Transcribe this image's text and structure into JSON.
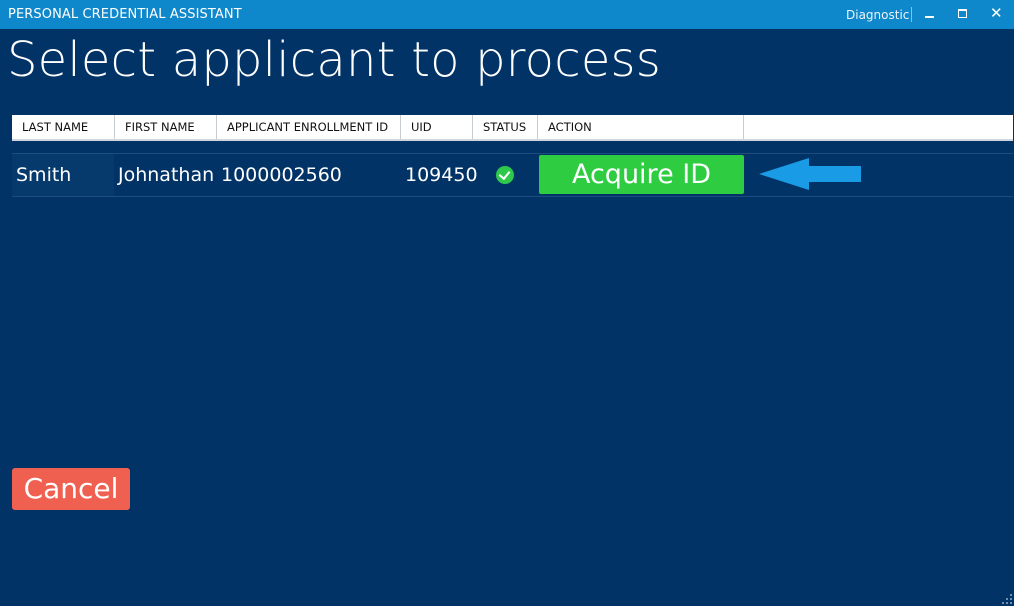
{
  "window": {
    "title": "PERSONAL CREDENTIAL ASSISTANT",
    "diagnostic_label": "Diagnostic",
    "controls": [
      "minimize",
      "maximize",
      "close"
    ]
  },
  "page": {
    "title": "Select applicant to process"
  },
  "table": {
    "columns": [
      "LAST NAME",
      "FIRST NAME",
      "APPLICANT ENROLLMENT ID",
      "UID",
      "STATUS",
      "ACTION"
    ],
    "rows": [
      {
        "last_name": "Smith",
        "first_name": "Johnathan",
        "enrollment_id": "1000002560",
        "uid": "109450",
        "status_icon": "check-circle-icon",
        "action_label": "Acquire ID"
      }
    ]
  },
  "footer": {
    "cancel_label": "Cancel"
  },
  "colors": {
    "background": "#013366",
    "titlebar": "#0f87cb",
    "acquire_button": "#2ecc40",
    "cancel_button": "#f06050",
    "arrow": "#1a9be6"
  }
}
